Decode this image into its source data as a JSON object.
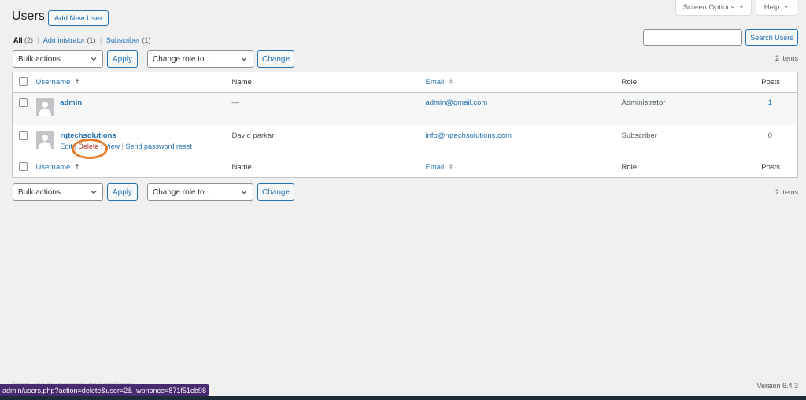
{
  "screen_meta": {
    "screen_options_label": "Screen Options",
    "help_label": "Help",
    "dropdown_glyph": "▼"
  },
  "header": {
    "title": "Users",
    "add_new_label": "Add New User"
  },
  "views": [
    {
      "label": "All",
      "count": "(2)",
      "current": true
    },
    {
      "label": "Administrator",
      "count": "(1)",
      "current": false
    },
    {
      "label": "Subscriber",
      "count": "(1)",
      "current": false
    }
  ],
  "search": {
    "value": "",
    "placeholder": "",
    "button_label": "Search Users"
  },
  "tablenav": {
    "bulk_actions_selected": "Bulk actions",
    "apply_label": "Apply",
    "change_role_selected": "Change role to...",
    "change_label": "Change",
    "items_count": "2 items"
  },
  "table": {
    "columns": {
      "username": "Username",
      "name": "Name",
      "email": "Email",
      "role": "Role",
      "posts": "Posts"
    },
    "rows": [
      {
        "username": "admin",
        "name": "—",
        "email": "admin@gmail.com",
        "role": "Administrator",
        "posts": "1",
        "row_actions": null
      },
      {
        "username": "rqtechsolutions",
        "name": "David parkar",
        "email": "info@rqtechsolutions.com",
        "role": "Subscriber",
        "posts": "0",
        "row_actions": {
          "edit": "Edit",
          "delete": "Delete",
          "view": "View",
          "reset": "Send password reset",
          "separator": "|"
        }
      }
    ]
  },
  "footer": {
    "thanks_text": "Thank you for creating with WordPress.",
    "version": "Version 6.4.3"
  },
  "status_bar": {
    "url": "-admin/users.php?action=delete&user=2&_wpnonce=871f51eb98"
  },
  "annotation": {
    "highlight_color": "#e57d2f",
    "highlights": "delete-link"
  }
}
